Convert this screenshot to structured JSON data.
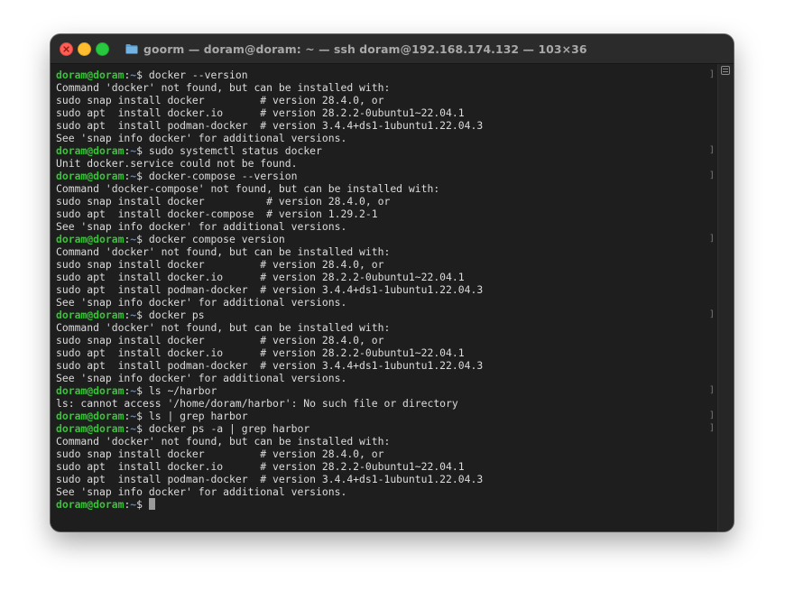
{
  "window": {
    "title": "goorm — doram@doram: ~ — ssh doram@192.168.174.132 — 103×36"
  },
  "prompt": {
    "user": "doram@doram",
    "colon": ":",
    "path": "~",
    "symbol": "$ "
  },
  "lines": [
    {
      "kind": "cmd",
      "text": "docker --version"
    },
    {
      "kind": "out",
      "text": "Command 'docker' not found, but can be installed with:"
    },
    {
      "kind": "out",
      "text": "sudo snap install docker         # version 28.4.0, or"
    },
    {
      "kind": "out",
      "text": "sudo apt  install docker.io      # version 28.2.2-0ubuntu1~22.04.1"
    },
    {
      "kind": "out",
      "text": "sudo apt  install podman-docker  # version 3.4.4+ds1-1ubuntu1.22.04.3"
    },
    {
      "kind": "out",
      "text": "See 'snap info docker' for additional versions."
    },
    {
      "kind": "cmd",
      "text": "sudo systemctl status docker"
    },
    {
      "kind": "out",
      "text": "Unit docker.service could not be found."
    },
    {
      "kind": "cmd",
      "text": "docker-compose --version"
    },
    {
      "kind": "out",
      "text": "Command 'docker-compose' not found, but can be installed with:"
    },
    {
      "kind": "out",
      "text": "sudo snap install docker          # version 28.4.0, or"
    },
    {
      "kind": "out",
      "text": "sudo apt  install docker-compose  # version 1.29.2-1"
    },
    {
      "kind": "out",
      "text": "See 'snap info docker' for additional versions."
    },
    {
      "kind": "cmd",
      "text": "docker compose version"
    },
    {
      "kind": "out",
      "text": "Command 'docker' not found, but can be installed with:"
    },
    {
      "kind": "out",
      "text": "sudo snap install docker         # version 28.4.0, or"
    },
    {
      "kind": "out",
      "text": "sudo apt  install docker.io      # version 28.2.2-0ubuntu1~22.04.1"
    },
    {
      "kind": "out",
      "text": "sudo apt  install podman-docker  # version 3.4.4+ds1-1ubuntu1.22.04.3"
    },
    {
      "kind": "out",
      "text": "See 'snap info docker' for additional versions."
    },
    {
      "kind": "cmd",
      "text": "docker ps"
    },
    {
      "kind": "out",
      "text": "Command 'docker' not found, but can be installed with:"
    },
    {
      "kind": "out",
      "text": "sudo snap install docker         # version 28.4.0, or"
    },
    {
      "kind": "out",
      "text": "sudo apt  install docker.io      # version 28.2.2-0ubuntu1~22.04.1"
    },
    {
      "kind": "out",
      "text": "sudo apt  install podman-docker  # version 3.4.4+ds1-1ubuntu1.22.04.3"
    },
    {
      "kind": "out",
      "text": "See 'snap info docker' for additional versions."
    },
    {
      "kind": "cmd",
      "text": "ls ~/harbor"
    },
    {
      "kind": "out",
      "text": "ls: cannot access '/home/doram/harbor': No such file or directory"
    },
    {
      "kind": "cmd",
      "text": "ls | grep harbor"
    },
    {
      "kind": "cmd",
      "text": "docker ps -a | grep harbor"
    },
    {
      "kind": "out",
      "text": "Command 'docker' not found, but can be installed with:"
    },
    {
      "kind": "out",
      "text": "sudo snap install docker         # version 28.4.0, or"
    },
    {
      "kind": "out",
      "text": "sudo apt  install docker.io      # version 28.2.2-0ubuntu1~22.04.1"
    },
    {
      "kind": "out",
      "text": "sudo apt  install podman-docker  # version 3.4.4+ds1-1ubuntu1.22.04.3"
    },
    {
      "kind": "out",
      "text": "See 'snap info docker' for additional versions."
    },
    {
      "kind": "cursor",
      "text": ""
    }
  ],
  "colors": {
    "user": "#37c437",
    "path": "#4e8bd8",
    "text": "#dcdcdc",
    "background": "#1e1e1e"
  },
  "icons": {
    "title": "folder-icon",
    "close": "close-icon",
    "scroll": "scroll-marks-icon"
  }
}
